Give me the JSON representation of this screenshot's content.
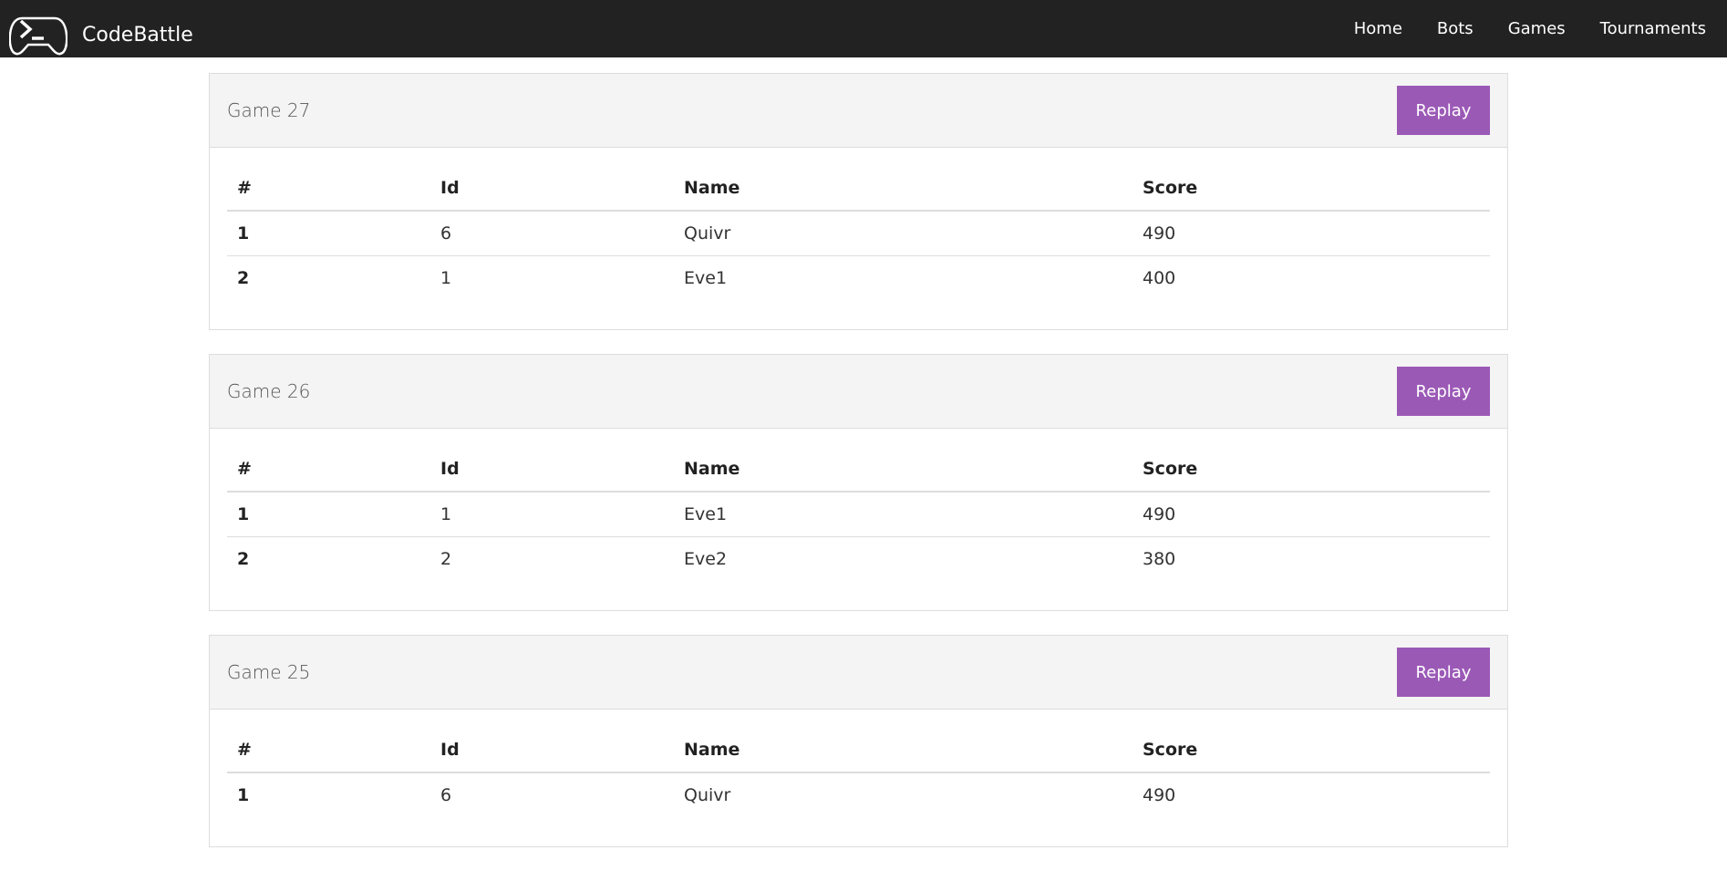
{
  "app": {
    "brand_name": "CodeBattle",
    "logo_icon": "gamepad-terminal-icon"
  },
  "nav": {
    "items": [
      "Home",
      "Bots",
      "Games",
      "Tournaments"
    ]
  },
  "colors": {
    "navbar": "#222222",
    "accent": "#9b59b6",
    "panel_heading": "#f4f4f4"
  },
  "table_headers": [
    "#",
    "Id",
    "Name",
    "Score"
  ],
  "games": [
    {
      "title": "Game 27",
      "replay_label": "Replay",
      "rows": [
        {
          "rank": "1",
          "id": "6",
          "name": "Quivr",
          "score": "490"
        },
        {
          "rank": "2",
          "id": "1",
          "name": "Eve1",
          "score": "400"
        }
      ]
    },
    {
      "title": "Game 26",
      "replay_label": "Replay",
      "rows": [
        {
          "rank": "1",
          "id": "1",
          "name": "Eve1",
          "score": "490"
        },
        {
          "rank": "2",
          "id": "2",
          "name": "Eve2",
          "score": "380"
        }
      ]
    },
    {
      "title": "Game 25",
      "replay_label": "Replay",
      "rows": [
        {
          "rank": "1",
          "id": "6",
          "name": "Quivr",
          "score": "490"
        }
      ]
    }
  ]
}
